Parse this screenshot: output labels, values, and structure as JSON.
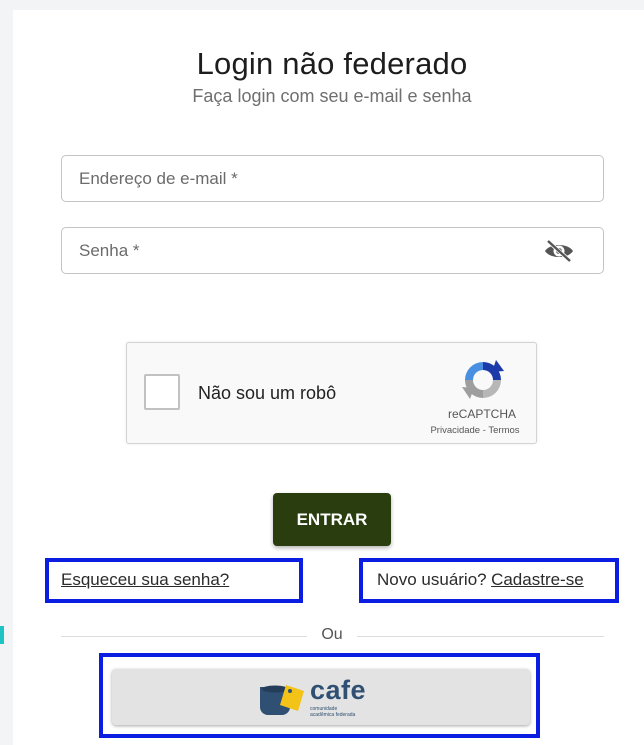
{
  "login": {
    "title": "Login não federado",
    "subtitle": "Faça login com seu e-mail e senha"
  },
  "form": {
    "email_placeholder": "Endereço de e-mail *",
    "password_placeholder": "Senha *",
    "password_toggle_icon": "eye-slash-icon"
  },
  "captcha": {
    "checkbox_label": "Não sou um robô",
    "brand": "reCAPTCHA",
    "privacy": "Privacidade",
    "separator": "-",
    "terms": "Termos"
  },
  "actions": {
    "submit_label": "ENTRAR",
    "forgot_password": "Esqueceu sua senha?",
    "new_user": "Novo usuário?",
    "signup": "Cadastre-se",
    "or_label": "Ou"
  },
  "federated": {
    "name": "cafe",
    "tagline_line1": "comunidade",
    "tagline_line2": "acadêmica federada"
  },
  "colors": {
    "primary_button": "#2a3d0e",
    "highlight_border": "#0a1de0",
    "cafe_brand": "#2f4f73",
    "cafe_accent": "#f3c318"
  }
}
